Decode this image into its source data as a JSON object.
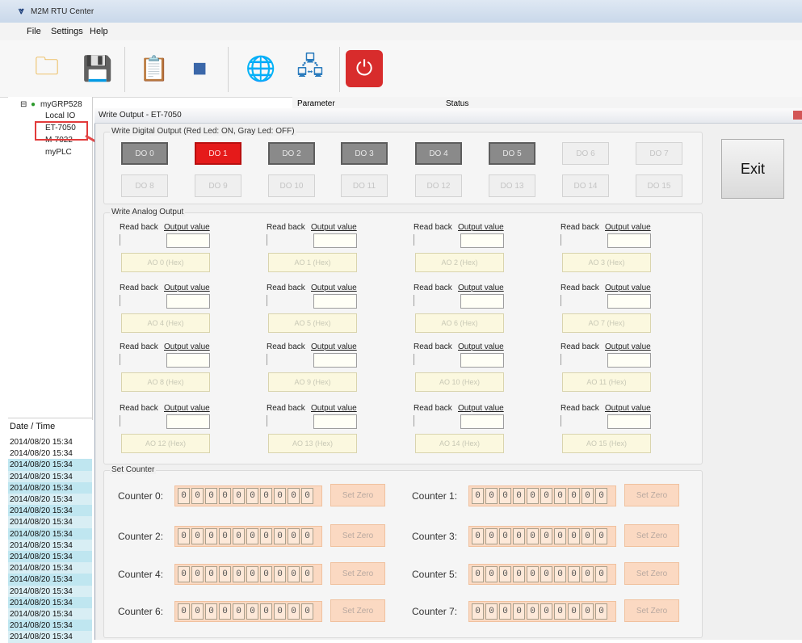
{
  "window": {
    "title": "M2M RTU Center"
  },
  "menu": [
    "File",
    "Settings",
    "Help"
  ],
  "toolbar_icons": [
    "open-folder-icon",
    "save-disk-icon",
    "notes-star-icon",
    "cube-icon",
    "globe-icon",
    "network-icon",
    "power-icon"
  ],
  "tree": {
    "root": "myGRP528",
    "items": [
      "Local IO",
      "ET-7050",
      "M-7022",
      "myPLC"
    ]
  },
  "columns": {
    "parameter": "Parameter",
    "status": "Status"
  },
  "log": {
    "header": "Date / Time",
    "rows": [
      "2014/08/20 15:34",
      "2014/08/20 15:34",
      "2014/08/20 15:34",
      "2014/08/20 15:34",
      "2014/08/20 15:34",
      "2014/08/20 15:34",
      "2014/08/20 15:34",
      "2014/08/20 15:34",
      "2014/08/20 15:34",
      "2014/08/20 15:34",
      "2014/08/20 15:34",
      "2014/08/20 15:34",
      "2014/08/20 15:34",
      "2014/08/20 15:34",
      "2014/08/20 15:34",
      "2014/08/20 15:34",
      "2014/08/20 15:34",
      "2014/08/20 15:34"
    ]
  },
  "dialog": {
    "title": "Write Output - ET-7050",
    "do_group_title": "Write Digital Output  (Red Led: ON, Gray Led: OFF)",
    "do": [
      {
        "label": "DO 0",
        "state": "gray"
      },
      {
        "label": "DO 1",
        "state": "red"
      },
      {
        "label": "DO 2",
        "state": "gray"
      },
      {
        "label": "DO 3",
        "state": "gray"
      },
      {
        "label": "DO 4",
        "state": "gray"
      },
      {
        "label": "DO 5",
        "state": "gray"
      },
      {
        "label": "DO 6",
        "state": "off"
      },
      {
        "label": "DO 7",
        "state": "off"
      },
      {
        "label": "DO 8",
        "state": "off"
      },
      {
        "label": "DO 9",
        "state": "off"
      },
      {
        "label": "DO 10",
        "state": "off"
      },
      {
        "label": "DO 11",
        "state": "off"
      },
      {
        "label": "DO 12",
        "state": "off"
      },
      {
        "label": "DO 13",
        "state": "off"
      },
      {
        "label": "DO 14",
        "state": "off"
      },
      {
        "label": "DO 15",
        "state": "off"
      }
    ],
    "exit_label": "Exit",
    "ao_group_title": "Write Analog Output",
    "ao_read_back": "Read back",
    "ao_output_value": "Output value",
    "ao": [
      "AO 0 (Hex)",
      "AO 1 (Hex)",
      "AO 2 (Hex)",
      "AO 3 (Hex)",
      "AO 4 (Hex)",
      "AO 5 (Hex)",
      "AO 6 (Hex)",
      "AO 7 (Hex)",
      "AO 8 (Hex)",
      "AO 9 (Hex)",
      "AO 10 (Hex)",
      "AO 11 (Hex)",
      "AO 12 (Hex)",
      "AO 13 (Hex)",
      "AO 14 (Hex)",
      "AO 15 (Hex)"
    ],
    "counter_group_title": "Set Counter",
    "counters": [
      {
        "label": "Counter 0:",
        "digits": [
          "0",
          "0",
          "0",
          "0",
          "0",
          "0",
          "0",
          "0",
          "0",
          "0"
        ],
        "button": "Set Zero"
      },
      {
        "label": "Counter 1:",
        "digits": [
          "0",
          "0",
          "0",
          "0",
          "0",
          "0",
          "0",
          "0",
          "0",
          "0"
        ],
        "button": "Set Zero"
      },
      {
        "label": "Counter 2:",
        "digits": [
          "0",
          "0",
          "0",
          "0",
          "0",
          "0",
          "0",
          "0",
          "0",
          "0"
        ],
        "button": "Set Zero"
      },
      {
        "label": "Counter 3:",
        "digits": [
          "0",
          "0",
          "0",
          "0",
          "0",
          "0",
          "0",
          "0",
          "0",
          "0"
        ],
        "button": "Set Zero"
      },
      {
        "label": "Counter 4:",
        "digits": [
          "0",
          "0",
          "0",
          "0",
          "0",
          "0",
          "0",
          "0",
          "0",
          "0"
        ],
        "button": "Set Zero"
      },
      {
        "label": "Counter 5:",
        "digits": [
          "0",
          "0",
          "0",
          "0",
          "0",
          "0",
          "0",
          "0",
          "0",
          "0"
        ],
        "button": "Set Zero"
      },
      {
        "label": "Counter 6:",
        "digits": [
          "0",
          "0",
          "0",
          "0",
          "0",
          "0",
          "0",
          "0",
          "0",
          "0"
        ],
        "button": "Set Zero"
      },
      {
        "label": "Counter 7:",
        "digits": [
          "0",
          "0",
          "0",
          "0",
          "0",
          "0",
          "0",
          "0",
          "0",
          "0"
        ],
        "button": "Set Zero"
      }
    ]
  }
}
